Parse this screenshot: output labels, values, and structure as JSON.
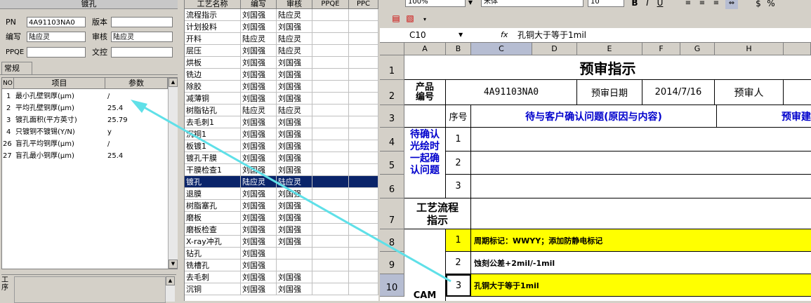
{
  "left": {
    "title": "镀孔",
    "fields": [
      {
        "label": "PN",
        "value": "4A91103NA0"
      },
      {
        "label": "版本",
        "value": ""
      },
      {
        "label": "编写",
        "value": "陆应灵"
      },
      {
        "label": "审核",
        "value": "陆应灵"
      },
      {
        "label": "PPQE",
        "value": ""
      },
      {
        "label": "文控",
        "value": ""
      }
    ],
    "tab": "常规",
    "grid_headers": [
      "NO",
      "项目",
      "参数"
    ],
    "grid_rows": [
      {
        "no": "1",
        "item": "最小孔壁铜厚(μm)",
        "param": "/"
      },
      {
        "no": "2",
        "item": "平均孔壁铜厚(μm)",
        "param": "25.4"
      },
      {
        "no": "3",
        "item": "镀孔面积(平方英寸)",
        "param": "25.79"
      },
      {
        "no": "4",
        "item": "只镀铜不镀锡(Y/N)",
        "param": "y"
      },
      {
        "no": "26",
        "item": "盲孔平均铜厚(μm)",
        "param": "/"
      },
      {
        "no": "27",
        "item": "盲孔最小铜厚(μm)",
        "param": "25.4"
      }
    ],
    "bottom_label": "工序"
  },
  "mid": {
    "headers": [
      "工艺名称",
      "编写",
      "审核",
      "PPQE",
      "PPC"
    ],
    "rows": [
      [
        "流程指示",
        "刘国强",
        "陆应灵"
      ],
      [
        "计划投料",
        "刘国强",
        "刘国强"
      ],
      [
        "开料",
        "陆应灵",
        "陆应灵"
      ],
      [
        "层压",
        "刘国强",
        "陆应灵"
      ],
      [
        "烘板",
        "刘国强",
        "刘国强"
      ],
      [
        "铣边",
        "刘国强",
        "刘国强"
      ],
      [
        "除胶",
        "刘国强",
        "刘国强"
      ],
      [
        "减薄铜",
        "刘国强",
        "刘国强"
      ],
      [
        "树脂钻孔",
        "陆应灵",
        "陆应灵"
      ],
      [
        "去毛刺1",
        "刘国强",
        "刘国强"
      ],
      [
        "沉铜1",
        "刘国强",
        "刘国强"
      ],
      [
        "板镀1",
        "刘国强",
        "刘国强"
      ],
      [
        "镀孔干膜",
        "刘国强",
        "刘国强"
      ],
      [
        "干膜检查1",
        "刘国强",
        "刘国强"
      ],
      [
        "镀孔",
        "陆应灵",
        "陆应灵"
      ],
      [
        "退膜",
        "刘国强",
        "刘国强"
      ],
      [
        "树脂塞孔",
        "刘国强",
        "刘国强"
      ],
      [
        "磨板",
        "刘国强",
        "刘国强"
      ],
      [
        "磨板检查",
        "刘国强",
        "刘国强"
      ],
      [
        "X-ray冲孔",
        "刘国强",
        "刘国强"
      ],
      [
        "钻孔",
        "刘国强",
        ""
      ],
      [
        "铣槽孔",
        "刘国强",
        ""
      ],
      [
        "去毛刺",
        "刘国强",
        "刘国强"
      ],
      [
        "沉铜",
        "刘国强",
        "刘国强"
      ]
    ],
    "selected_index": 14
  },
  "excel": {
    "toolbar": {
      "zoom": "100%",
      "font": "宋体",
      "size": "10",
      "bold": "B",
      "italic": "I",
      "underline": "U",
      "percent": "%"
    },
    "name_box": "C10",
    "fx": "fx",
    "formula": "孔铜大于等于1mil",
    "columns": [
      "A",
      "B",
      "C",
      "D",
      "E",
      "F",
      "G",
      "H"
    ],
    "rows": [
      "1",
      "2",
      "3",
      "4",
      "5",
      "6",
      "7",
      "8",
      "9",
      "10"
    ],
    "title": "预审指示",
    "product_label": "产品\n编号",
    "product_no": "4A91103NA0",
    "review_date_label": "预审日期",
    "review_date": "2014/7/16",
    "reviewer_label": "预审人",
    "seq_label": "序号",
    "pending_label": "待与客户确认问题(原因与内容)",
    "pre_label": "预审建",
    "confirm_label": "待确认\n光绘时\n一起确\n认问题",
    "seq": [
      "1",
      "2",
      "3"
    ],
    "flow_label": "工艺流程\n指示",
    "cam_label": "CAM",
    "instructions": [
      {
        "no": "1",
        "text": "周期标记：WWYY；添加防静电标记"
      },
      {
        "no": "2",
        "text": "蚀刻公差+2mil/-1mil"
      },
      {
        "no": "3",
        "text": "孔铜大于等于1mil"
      }
    ]
  }
}
